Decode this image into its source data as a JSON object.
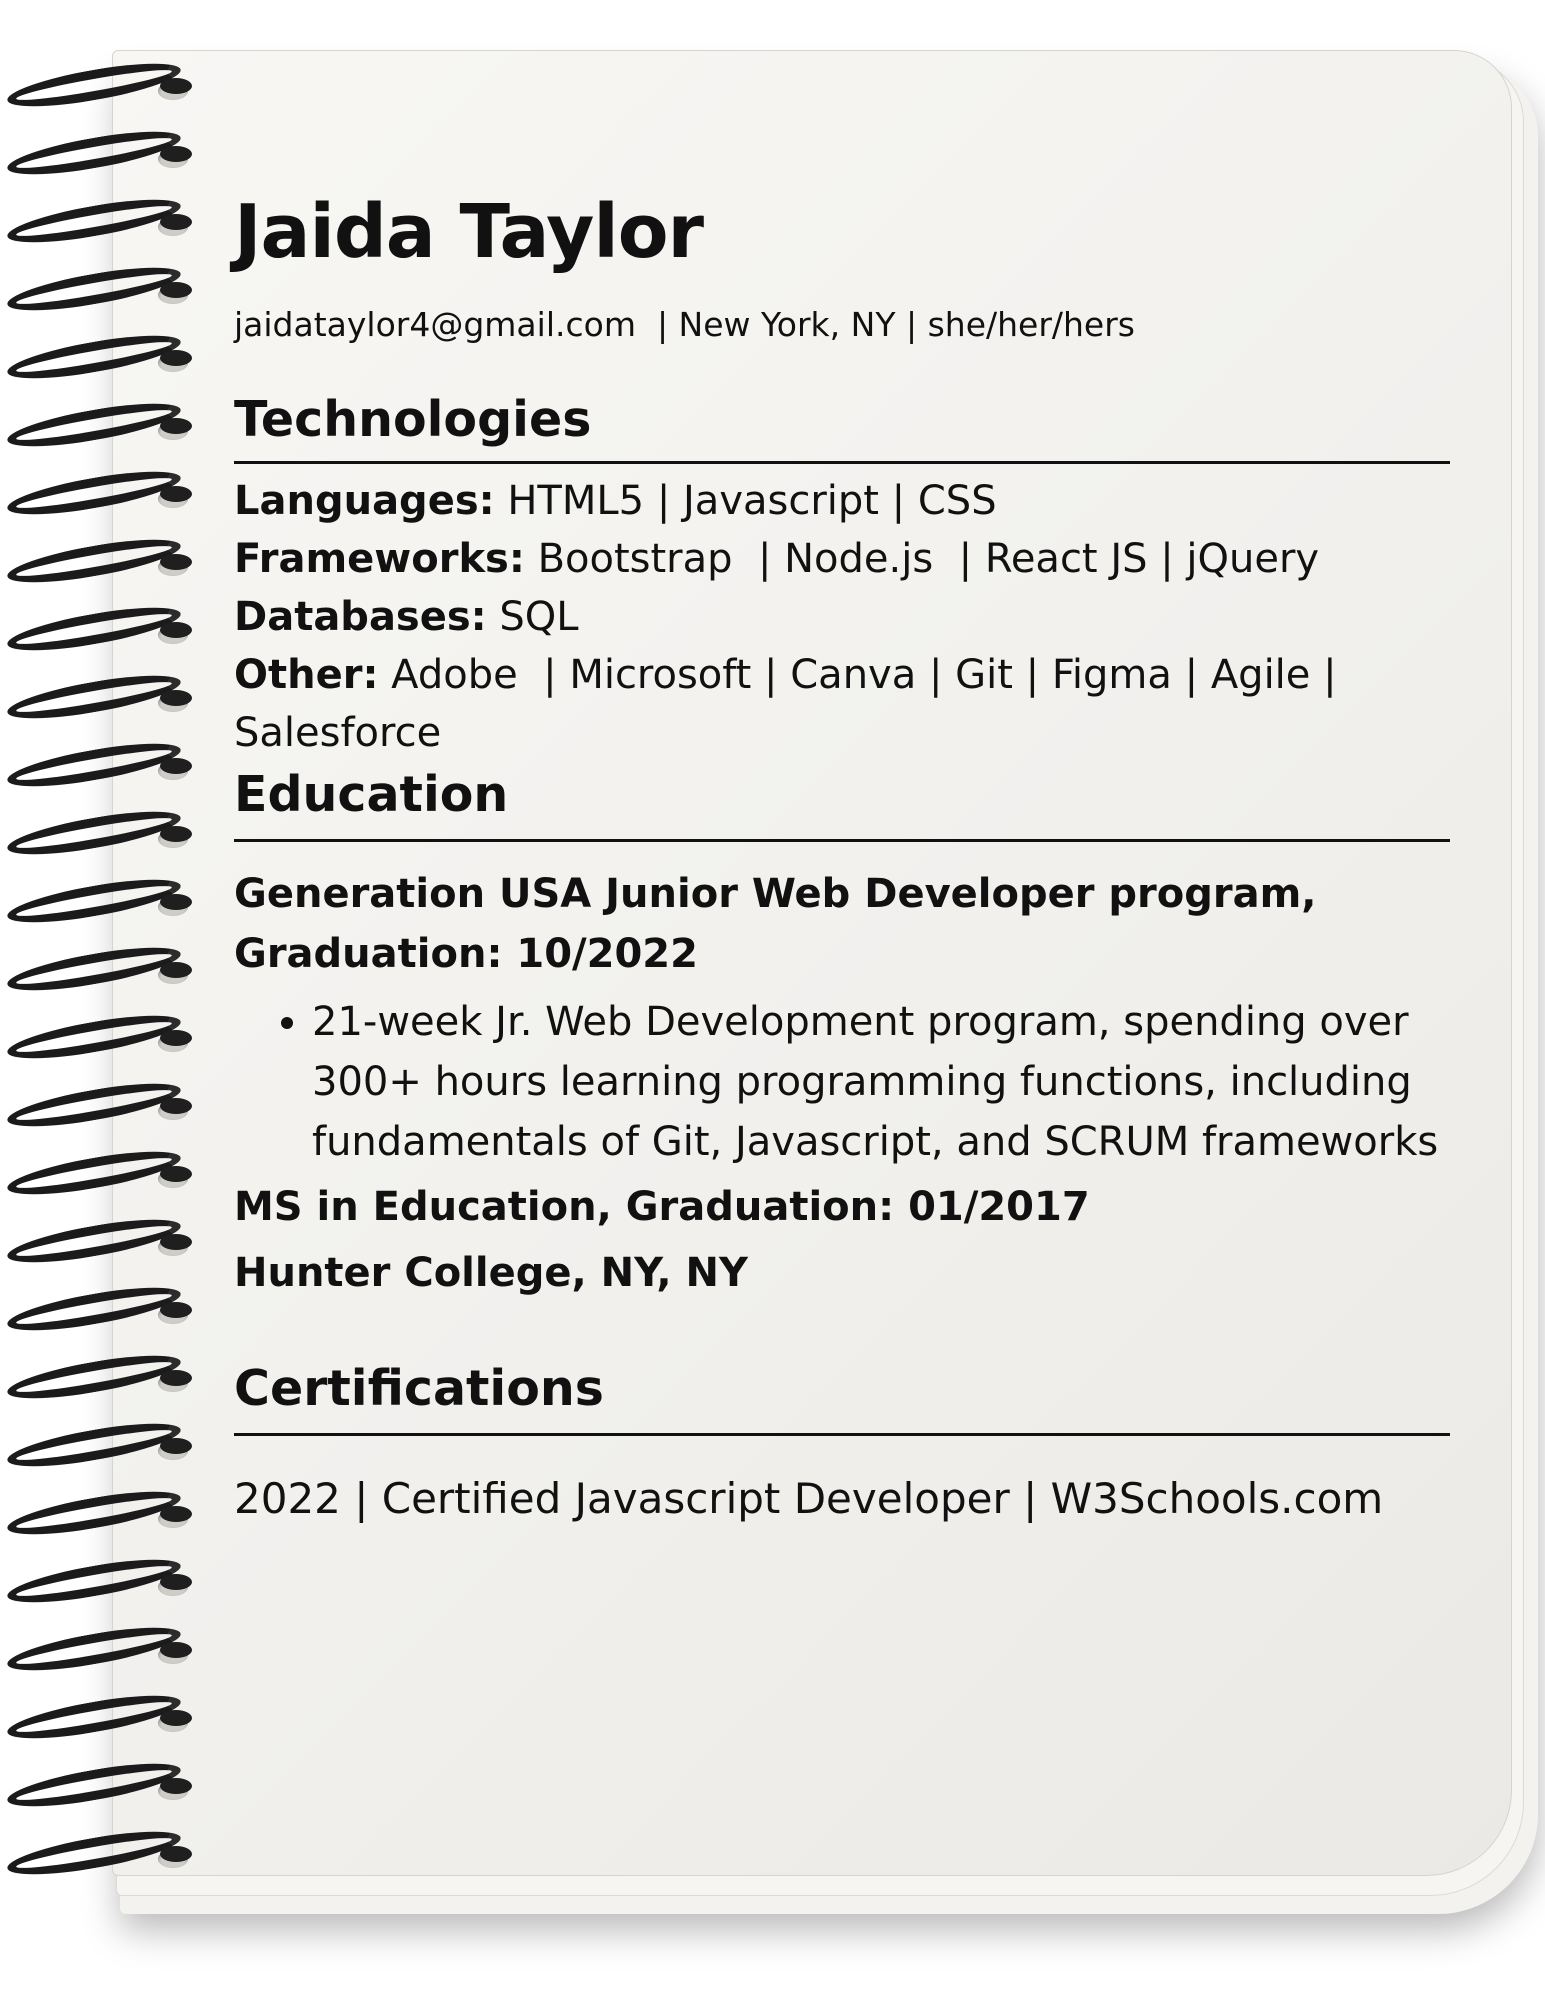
{
  "header": {
    "name": "Jaida Taylor",
    "contact": "jaidataylor4@gmail.com  | New York, NY | she/her/hers"
  },
  "technologies": {
    "title": "Technologies",
    "rows": [
      {
        "label": "Languages:",
        "value": " HTML5 | Javascript | CSS"
      },
      {
        "label": "Frameworks:",
        "value": " Bootstrap  | Node.js  | React JS | jQuery"
      },
      {
        "label": "Databases:",
        "value": " SQL"
      },
      {
        "label": "Other:",
        "value": " Adobe  | Microsoft | Canva | Git | Figma | Agile | Salesforce"
      }
    ]
  },
  "education": {
    "title": "Education",
    "program_line1": "Generation USA Junior Web Developer program,",
    "program_line2": "Graduation: 10/2022",
    "bullet": "21-week Jr. Web Development program, spending over 300+ hours learning programming functions, including fundamentals of Git, Javascript, and SCRUM frameworks",
    "degree": "MS in Education, Graduation: 01/2017",
    "school": "Hunter College, NY, NY"
  },
  "certifications": {
    "title": "Certifications",
    "line": "2022 | Certified Javascript Developer | W3Schools.com"
  }
}
